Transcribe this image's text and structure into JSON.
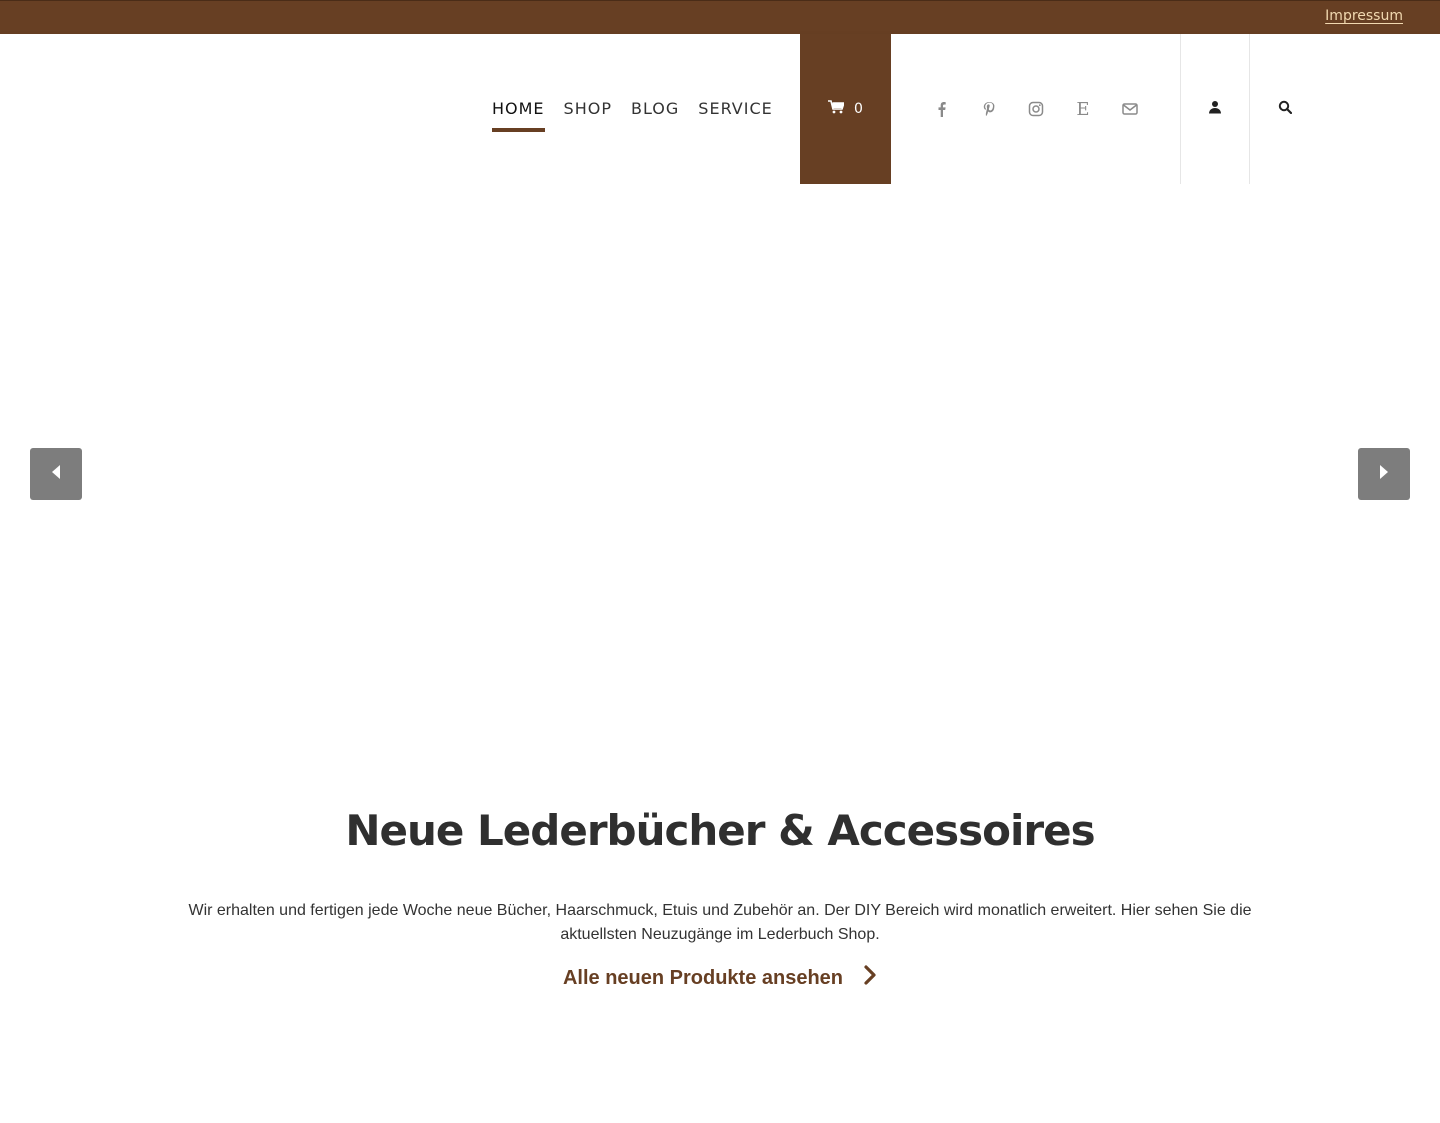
{
  "topbar": {
    "impressum": "Impressum"
  },
  "nav": {
    "home": "HOME",
    "shop": "SHOP",
    "blog": "BLOG",
    "service": "SERVICE"
  },
  "cart": {
    "count": "0"
  },
  "social": [
    "facebook-icon",
    "pinterest-icon",
    "instagram-icon",
    "etsy-icon",
    "mail-icon"
  ],
  "etsy_letter": "E",
  "icons": {
    "account": "user-icon",
    "search": "search-icon",
    "prev": "caret-left-icon",
    "next": "caret-right-icon"
  },
  "section": {
    "title": "Neue Lederbücher & Accessoires",
    "text": "Wir erhalten und fertigen jede Woche neue Bücher, Haarschmuck, Etuis und Zubehör an. Der DIY Bereich wird monatlich erweitert. Hier sehen Sie die aktuellsten Neuzugänge im Lederbuch Shop.",
    "cta": "Alle neuen Produkte ansehen"
  },
  "colors": {
    "brand": "#673f23",
    "impressum": "#f1d8b0",
    "arrow_bg": "#7d7d7d"
  }
}
